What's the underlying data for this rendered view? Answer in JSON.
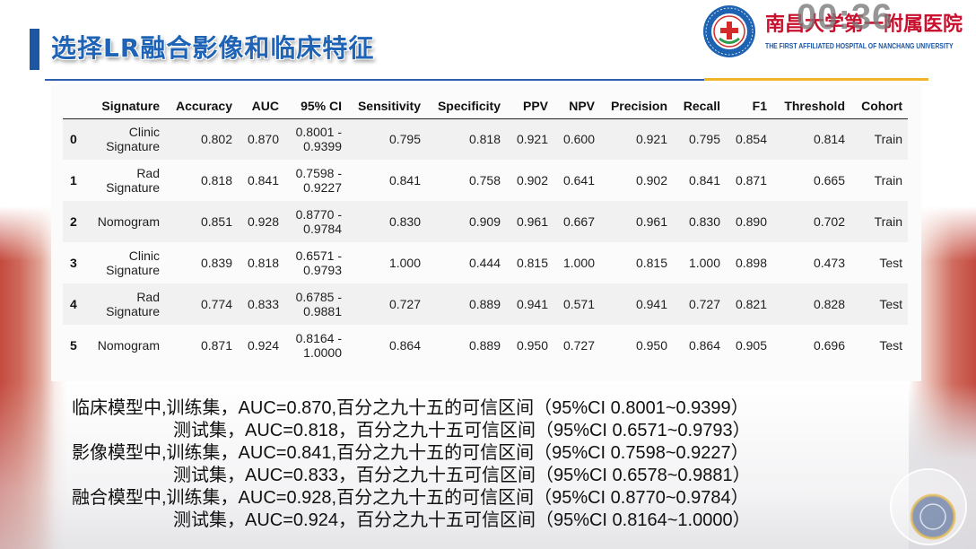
{
  "overlay": {
    "timer": "00:36"
  },
  "header": {
    "title": "选择LR融合影像和临床特征",
    "hospital": {
      "name_cn": "南昌大学第一附属医院",
      "name_en": "THE FIRST AFFILIATED HOSPITAL OF NANCHANG UNIVERSITY"
    }
  },
  "table": {
    "columns": [
      "Signature",
      "Accuracy",
      "AUC",
      "95% CI",
      "Sensitivity",
      "Specificity",
      "PPV",
      "NPV",
      "Precision",
      "Recall",
      "F1",
      "Threshold",
      "Cohort"
    ],
    "rows": [
      {
        "index": "0",
        "cells": [
          "Clinic Signature",
          "0.802",
          "0.870",
          "0.8001 - 0.9399",
          "0.795",
          "0.818",
          "0.921",
          "0.600",
          "0.921",
          "0.795",
          "0.854",
          "0.814",
          "Train"
        ]
      },
      {
        "index": "1",
        "cells": [
          "Rad Signature",
          "0.818",
          "0.841",
          "0.7598 - 0.9227",
          "0.841",
          "0.758",
          "0.902",
          "0.641",
          "0.902",
          "0.841",
          "0.871",
          "0.665",
          "Train"
        ]
      },
      {
        "index": "2",
        "cells": [
          "Nomogram",
          "0.851",
          "0.928",
          "0.8770 - 0.9784",
          "0.830",
          "0.909",
          "0.961",
          "0.667",
          "0.961",
          "0.830",
          "0.890",
          "0.702",
          "Train"
        ]
      },
      {
        "index": "3",
        "cells": [
          "Clinic Signature",
          "0.839",
          "0.818",
          "0.6571 - 0.9793",
          "1.000",
          "0.444",
          "0.815",
          "1.000",
          "0.815",
          "1.000",
          "0.898",
          "0.473",
          "Test"
        ]
      },
      {
        "index": "4",
        "cells": [
          "Rad Signature",
          "0.774",
          "0.833",
          "0.6785 - 0.9881",
          "0.727",
          "0.889",
          "0.941",
          "0.571",
          "0.941",
          "0.727",
          "0.821",
          "0.828",
          "Test"
        ]
      },
      {
        "index": "5",
        "cells": [
          "Nomogram",
          "0.871",
          "0.924",
          "0.8164 - 1.0000",
          "0.864",
          "0.889",
          "0.950",
          "0.727",
          "0.950",
          "0.864",
          "0.905",
          "0.696",
          "Test"
        ]
      }
    ]
  },
  "notes": [
    "临床模型中,训练集，AUC=0.870,百分之九十五的可信区间（95%CI 0.8001~0.9399）",
    "测试集，AUC=0.818，百分之九十五可信区间（95%CI 0.6571~0.9793）",
    "影像模型中,训练集，AUC=0.841,百分之九十五的可信区间（95%CI 0.7598~0.9227）",
    "测试集，AUC=0.833，百分之九十五可信区间（95%CI 0.6578~0.9881）",
    "融合模型中,训练集，AUC=0.928,百分之九十五的可信区间（95%CI 0.8770~0.9784）",
    "测试集，AUC=0.924，百分之九十五可信区间（95%CI 0.8164~1.0000）"
  ],
  "colors": {
    "title_blue": "#1f63b6",
    "accent_bar_blue": "#1d56a3",
    "rule_blue": "#2d61ab",
    "rule_gold": "#f0b429",
    "hospital_red": "#c8102e",
    "hospital_blue": "#1b55a3",
    "row_stripe": "#f1f1f1"
  }
}
